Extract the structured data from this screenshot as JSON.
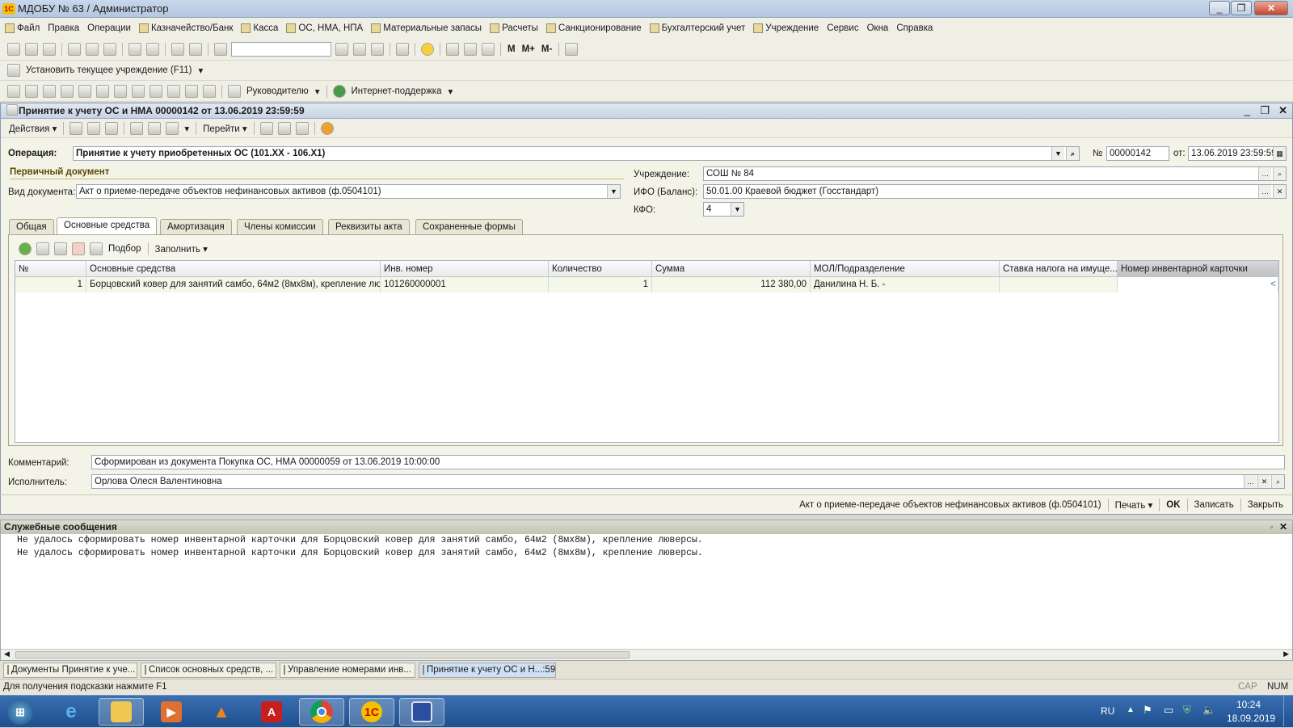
{
  "app": {
    "title": "МДОБУ № 63  / Администратор"
  },
  "menu": [
    "Файл",
    "Правка",
    "Операции",
    "Казначейство/Банк",
    "Касса",
    "ОС, НМА, НПА",
    "Материальные запасы",
    "Расчеты",
    "Санкционирование",
    "Бухгалтерский учет",
    "Учреждение",
    "Сервис",
    "Окна",
    "Справка"
  ],
  "toolbar": {
    "search_value": "",
    "m": "M",
    "mplus": "M+",
    "mminus": "M-"
  },
  "toolbar2": {
    "set_institution": "Установить текущее учреждение (F11)"
  },
  "toolbar3": {
    "manager": "Руководителю",
    "internet_support": "Интернет-поддержка"
  },
  "doc": {
    "title": "Принятие к учету ОС и НМА 00000142 от 13.06.2019 23:59:59",
    "actions_label": "Действия",
    "goto_label": "Перейти",
    "operation_label": "Операция:",
    "operation_value": "Принятие к учету приобретенных ОС (101.XX - 106.X1)",
    "number_label": "№",
    "number_value": "00000142",
    "date_label": "от:",
    "date_value": "13.06.2019 23:59:59",
    "primary_doc": "Первичный документ",
    "doc_type_label": "Вид документа:",
    "doc_type_value": "Акт о приеме-передаче объектов нефинансовых активов (ф.0504101)",
    "institution_label": "Учреждение:",
    "institution_value": "СОШ № 84",
    "ifo_label": "ИФО (Баланс):",
    "ifo_value": "50.01.00 Краевой бюджет (Госстандарт)",
    "kfo_label": "КФО:",
    "kfo_value": "4",
    "tabs": [
      "Общая",
      "Основные средства",
      "Амортизация",
      "Члены комиссии",
      "Реквизиты акта",
      "Сохраненные формы"
    ],
    "grid_toolbar": {
      "pick": "Подбор",
      "fill": "Заполнить"
    },
    "grid": {
      "columns": [
        "№",
        "Основные средства",
        "Инв. номер",
        "Количество",
        "Сумма",
        "МОЛ/Подразделение",
        "Ставка налога на имуще...",
        "Номер инвентарной карточки"
      ],
      "rows": [
        {
          "n": "1",
          "asset": "Борцовский ковер для занятий самбо, 64м2 (8мх8м), крепление люв...",
          "inv": "101260000001",
          "qty": "1",
          "sum": "112 380,00",
          "mol": "Данилина Н. Б. -",
          "tax": "",
          "card": ""
        }
      ]
    },
    "comment_label": "Комментарий:",
    "comment_value": "Сформирован из документа Покупка ОС, НМА 00000059 от 13.06.2019 10:00:00",
    "executor_label": "Исполнитель:",
    "executor_value": "Орлова Олеся Валентиновна",
    "footer": {
      "act": "Акт о приеме-передаче объектов нефинансовых активов (ф.0504101)",
      "print": "Печать",
      "ok": "OK",
      "save": "Записать",
      "close": "Закрыть"
    }
  },
  "messages": {
    "title": "Служебные сообщения",
    "lines": [
      "Не удалось сформировать номер инвентарной карточки для Борцовский ковер для занятий самбо, 64м2 (8мх8м), крепление люверсы.",
      "Не удалось сформировать номер инвентарной карточки для Борцовский ковер для занятий самбо, 64м2 (8мх8м), крепление люверсы."
    ]
  },
  "window_tabs": [
    "Документы Принятие к уче...",
    "Список основных средств, ...",
    "Управление номерами инв...",
    "Принятие к учету ОС и Н...:59"
  ],
  "status": {
    "hint": "Для получения подсказки нажмите F1",
    "cap": "CAP",
    "num": "NUM"
  },
  "taskbar": {
    "lang": "RU",
    "time": "10:24",
    "date": "18.09.2019"
  }
}
